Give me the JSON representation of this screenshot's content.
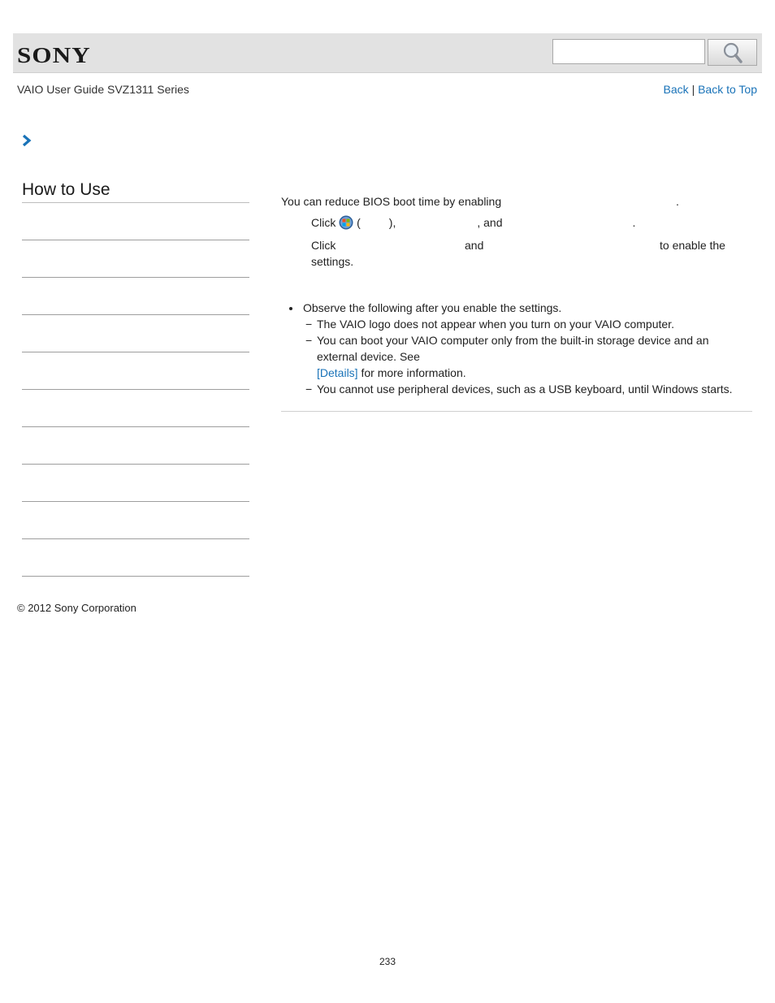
{
  "header": {
    "brand": "SONY",
    "search": {
      "placeholder": "",
      "value": ""
    },
    "search_icon": "magnifier-icon"
  },
  "subheader": {
    "guide_title": "VAIO User Guide SVZ1311 Series",
    "back_label": "Back",
    "separator": "|",
    "back_to_top_label": "Back to Top"
  },
  "breadcrumb": {
    "icon": "chevron-right-icon"
  },
  "sidebar": {
    "title": "How to Use",
    "items": [
      "",
      "",
      "",
      "",
      "",
      "",
      "",
      "",
      "",
      ""
    ]
  },
  "content": {
    "intro_text": "You can reduce BIOS boot time by enabling",
    "intro_end": ".",
    "step1": {
      "click": "Click",
      "open_paren": "(",
      "close_paren": "),",
      "and": ", and",
      "end": "."
    },
    "step2": {
      "click": "Click",
      "and": "and",
      "tail": "to enable the",
      "line2": "settings."
    },
    "notes": {
      "bullet": "Observe the following after you enable the settings.",
      "dash": "−",
      "items": [
        "The VAIO logo does not appear when you turn on your VAIO computer.",
        "You can boot your VAIO computer only from the built-in storage device and an",
        "You cannot use peripheral devices, such as a USB keyboard, until Windows starts."
      ],
      "item2_line2": "external device. See",
      "details_link": "[Details]",
      "item2_line3": "for more information."
    }
  },
  "footer": {
    "copyright": "© 2012 Sony Corporation",
    "page_number": "233"
  }
}
